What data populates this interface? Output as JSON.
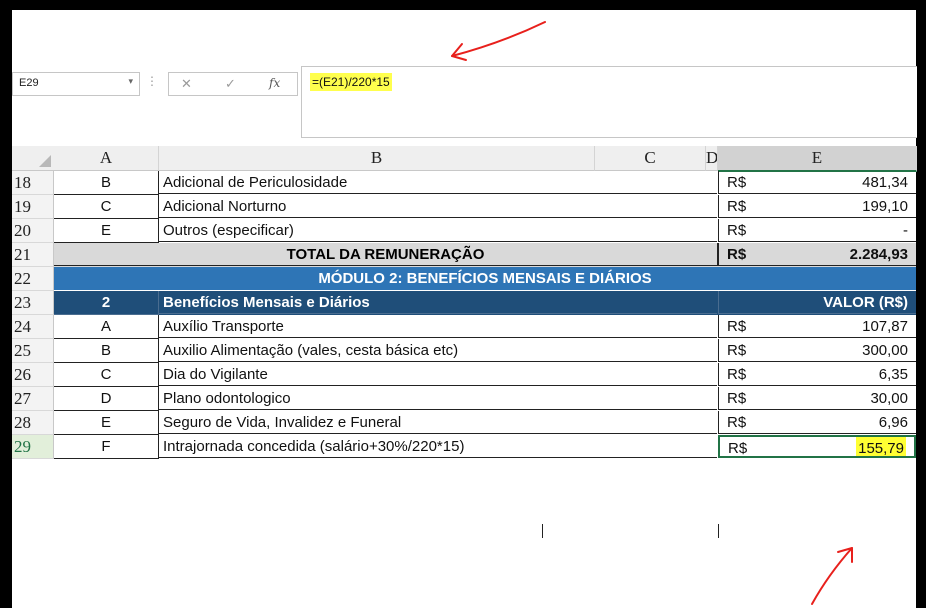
{
  "formula_bar": {
    "cell_ref": "E29",
    "dropdown_icon": "▾",
    "separator": "⋮",
    "cancel_icon": "✕",
    "enter_icon": "✓",
    "fx_label": "fx",
    "formula": "=(E21)/220*15"
  },
  "columns": {
    "A": "A",
    "B": "B",
    "C": "C",
    "D": "D",
    "E": "E"
  },
  "rows": [
    {
      "num": "18",
      "a": "B",
      "b": "Adicional de Periculosidade",
      "cur": "R$",
      "val": "481,34"
    },
    {
      "num": "19",
      "a": "C",
      "b": "Adicional Norturno",
      "cur": "R$",
      "val": "199,10"
    },
    {
      "num": "20",
      "a": "E",
      "b": "Outros (especificar)",
      "cur": "R$",
      "val": "-"
    }
  ],
  "total": {
    "num": "21",
    "label": "TOTAL DA REMUNERAÇÃO",
    "cur": "R$",
    "val": "2.284,93"
  },
  "module": {
    "num": "22",
    "label": "MÓDULO 2: BENEFÍCIOS MENSAIS E DIÁRIOS"
  },
  "section": {
    "num": "23",
    "a": "2",
    "b": "Benefícios Mensais  e Diários",
    "e": "VALOR (R$)"
  },
  "benefits": [
    {
      "num": "24",
      "a": "A",
      "b": "Auxílio Transporte",
      "cur": "R$",
      "val": "107,87"
    },
    {
      "num": "25",
      "a": "B",
      "b": "Auxilio Alimentação (vales, cesta básica etc)",
      "cur": "R$",
      "val": "300,00"
    },
    {
      "num": "26",
      "a": "C",
      "b": "Dia do Vigilante",
      "cur": "R$",
      "val": "6,35"
    },
    {
      "num": "27",
      "a": "D",
      "b": "Plano odontologico",
      "cur": "R$",
      "val": "30,00"
    },
    {
      "num": "28",
      "a": "E",
      "b": "Seguro de Vida, Invalidez e Funeral",
      "cur": "R$",
      "val": "6,96"
    },
    {
      "num": "29",
      "a": "F",
      "b": "Intrajornada concedida (salário+30%/220*15)",
      "cur": "R$",
      "val": "155,79"
    }
  ],
  "colors": {
    "header_blue": "#2e75b6",
    "section_navy": "#1f4e79",
    "total_gray": "#d9d9d9",
    "highlight": "#ffff33",
    "arrow": "#e8201c",
    "excel_green": "#217346"
  }
}
